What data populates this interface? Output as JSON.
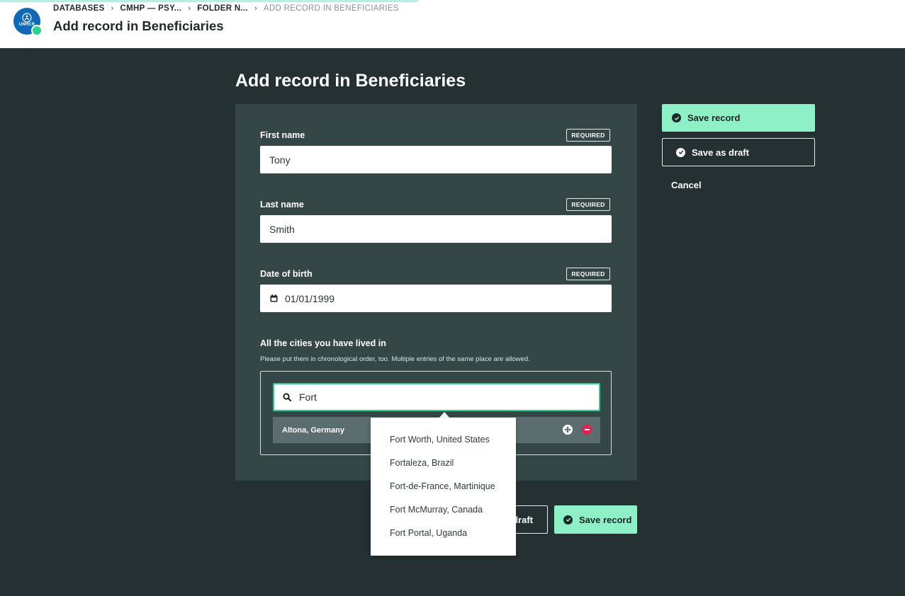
{
  "header": {
    "logo_text": "UNHCR",
    "breadcrumb": [
      "DATABASES",
      "CMHP — PSY...",
      "FOLDER N...",
      "ADD RECORD IN BENEFICIARIES"
    ],
    "breadcrumb_separator": "›",
    "title": "Add record in Beneficiaries"
  },
  "form": {
    "title": "Add record in Beneficiaries",
    "fields": [
      {
        "label": "First name",
        "badge": "REQUIRED",
        "value": "Tony"
      },
      {
        "label": "Last name",
        "badge": "REQUIRED",
        "value": "Smith"
      },
      {
        "label": "Date of birth",
        "badge": "REQUIRED",
        "value": "01/01/1999",
        "icon": "calendar-icon"
      }
    ],
    "cities": {
      "label": "All the cities you have lived in",
      "help": "Please put them in chronological order, too. Multiple entries of the same place are allowed.",
      "search_value": "Fort",
      "entries": [
        {
          "name": "Altona, Germany"
        }
      ],
      "suggestions": [
        "Fort Worth, United States",
        "Fortaleza, Brazil",
        "Fort-de-France, Martinique",
        "Fort McMurray, Canada",
        "Fort Portal, Uganda"
      ]
    }
  },
  "actions": {
    "save_record": "Save record",
    "save_draft": "Save as draft",
    "cancel": "Cancel",
    "bottom_draft_visible": "draft",
    "bottom_save": "Save record"
  },
  "colors": {
    "background_dark": "#243032",
    "card": "#354647",
    "accent_green": "#8ef0c7",
    "focus_border": "#2ecb8f",
    "remove_red": "#e0224e",
    "brand_blue": "#0f69b6"
  }
}
